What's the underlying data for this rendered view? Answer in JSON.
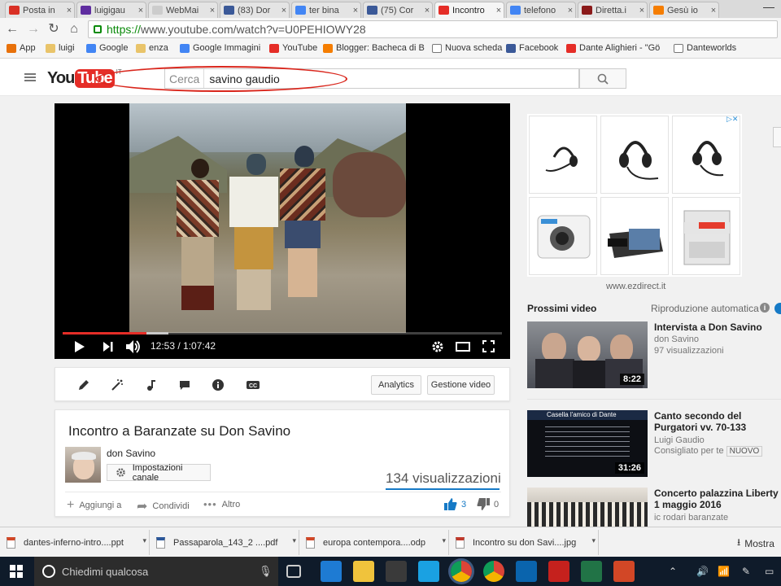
{
  "browser": {
    "tabs": [
      {
        "label": "Posta in",
        "icon": "gmail-icon",
        "color": "#d93025"
      },
      {
        "label": "luigigau",
        "icon": "yahoo-mail-icon",
        "color": "#5f2da0"
      },
      {
        "label": "WebMai",
        "icon": "webmail-icon",
        "color": "#cccccc"
      },
      {
        "label": "(83) Dor",
        "icon": "facebook-icon",
        "color": "#3b5998"
      },
      {
        "label": "ter bina",
        "icon": "google-icon",
        "color": "#4285f4"
      },
      {
        "label": "(75) Cor",
        "icon": "facebook-icon",
        "color": "#3b5998"
      },
      {
        "label": "Incontro",
        "icon": "youtube-icon",
        "color": "#e52d27"
      },
      {
        "label": "telefono",
        "icon": "google-icon",
        "color": "#4285f4"
      },
      {
        "label": "Diretta.i",
        "icon": "diretta-icon",
        "color": "#8b1a1a"
      },
      {
        "label": "Gesù io",
        "icon": "blogger-icon",
        "color": "#f57d00"
      }
    ],
    "url_scheme": "https://",
    "url_rest": "www.youtube.com/watch?v=U0PEHIOWY28",
    "bookmarks": [
      {
        "label": "App",
        "icon": "apps-icon"
      },
      {
        "label": "luigi",
        "icon": "folder-icon"
      },
      {
        "label": "Google",
        "icon": "google-icon"
      },
      {
        "label": "enza",
        "icon": "folder-icon"
      },
      {
        "label": "Google Immagini",
        "icon": "google-icon"
      },
      {
        "label": "YouTube",
        "icon": "youtube-icon"
      },
      {
        "label": "Blogger: Bacheca di B",
        "icon": "blogger-icon"
      },
      {
        "label": "Nuova scheda",
        "icon": "page-icon"
      },
      {
        "label": "Facebook",
        "icon": "facebook-icon"
      },
      {
        "label": "Dante Alighieri - \"Gö",
        "icon": "youtube-icon"
      },
      {
        "label": "Danteworlds",
        "icon": "page-icon"
      }
    ]
  },
  "youtube": {
    "logo_you": "You",
    "logo_tube": "Tube",
    "logo_country": "IT",
    "search_label": "Cerca",
    "search_value": "savino gaudio"
  },
  "video": {
    "time_current": "12:53",
    "time_total": "1:07:42",
    "progress_played": 0.19,
    "progress_buffered": 0.24,
    "tool_buttons": {
      "analytics": "Analytics",
      "manager": "Gestione video"
    },
    "title": "Incontro a Baranzate su Don Savino",
    "channel": "don Savino",
    "channel_settings": "Impostazioni canale",
    "views": "134 visualizzazioni",
    "actions": {
      "add": "Aggiungi a",
      "share": "Condividi",
      "more": "Altro"
    },
    "likes": "3",
    "dislikes": "0"
  },
  "ad": {
    "domain": "www.ezdirect.it"
  },
  "sidebar": {
    "up_next": "Prossimi video",
    "autoplay": "Riproduzione automatica",
    "items": [
      {
        "title": "Intervista a Don Savino",
        "channel": "don Savino",
        "meta": "97 visualizzazioni",
        "duration": "8:22"
      },
      {
        "title": "Canto secondo del Purgatori vv. 70-133",
        "channel": "Luigi Gaudio",
        "meta": "Consigliato per te",
        "badge": "NUOVO",
        "duration": "31:26",
        "thumb_text": "Casella l'amico di Dante"
      },
      {
        "title": "Concerto palazzina Liberty 1 maggio 2016",
        "channel": "ic rodari baranzate",
        "meta": "",
        "duration": ""
      }
    ]
  },
  "downloads": [
    {
      "name": "dantes-inferno-intro....ppt",
      "color": "#d24726"
    },
    {
      "name": "Passaparola_143_2 ....pdf",
      "color": "#2b579a"
    },
    {
      "name": "europa contempora....odp",
      "color": "#d24726"
    },
    {
      "name": "Incontro su don Savi....jpg",
      "color": "#c0392b"
    }
  ],
  "show_all": "Mostra",
  "taskbar": {
    "cortana_text": "Chiedimi qualcosa",
    "apps": [
      "task-view-icon",
      "edge-icon",
      "file-explorer-icon",
      "store-icon",
      "sky-go-icon",
      "chrome-icon",
      "chrome-icon",
      "outlook-icon",
      "filezilla-icon",
      "excel-icon",
      "powerpoint-icon"
    ]
  }
}
